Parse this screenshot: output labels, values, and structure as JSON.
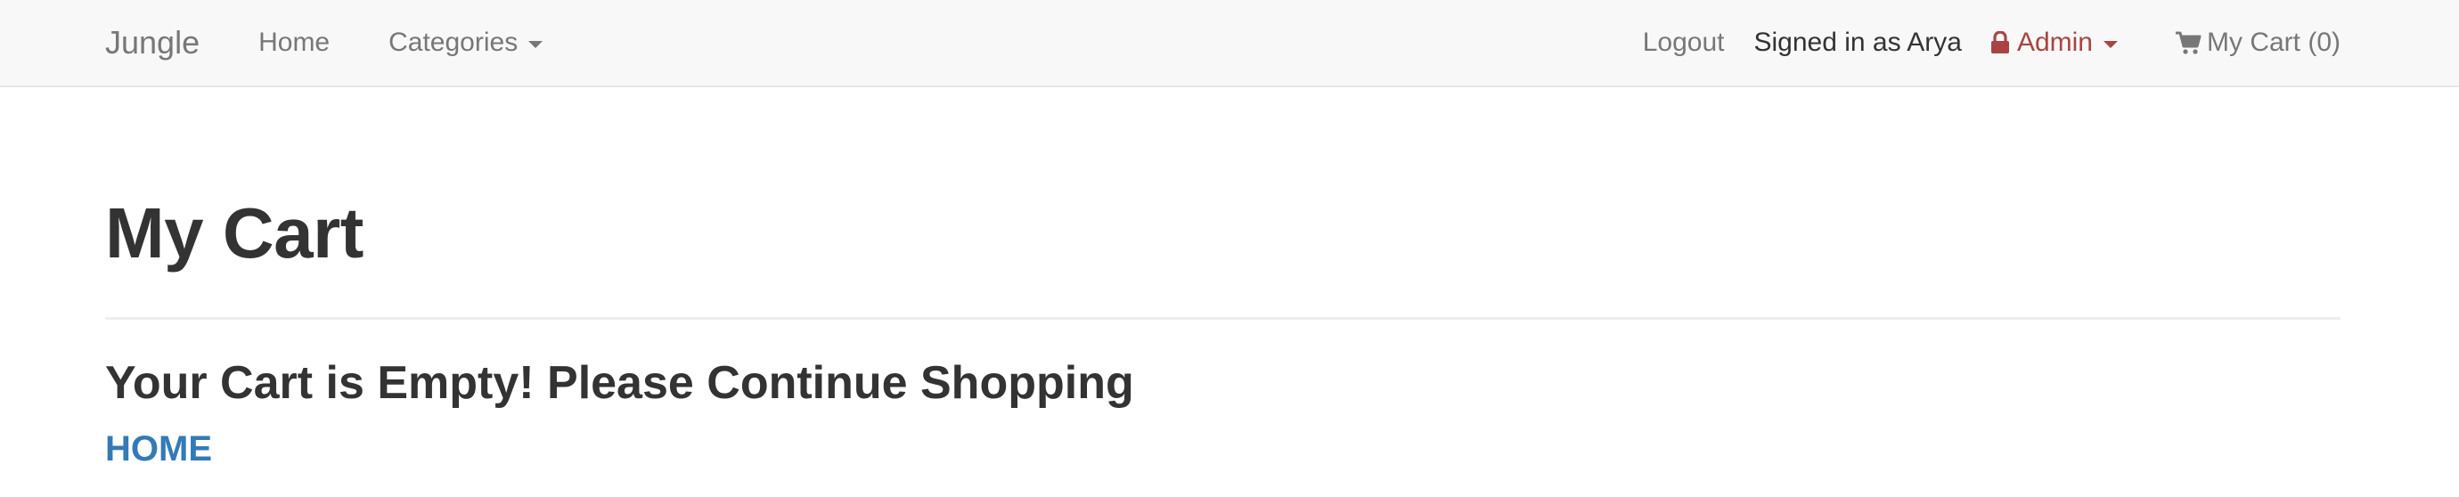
{
  "navbar": {
    "brand": "Jungle",
    "home_label": "Home",
    "categories_label": "Categories",
    "logout_label": "Logout",
    "signed_in_text": "Signed in as Arya",
    "admin_label": "Admin",
    "cart_label": "My Cart (0)",
    "icons": {
      "admin": "lock-icon",
      "cart": "shopping-cart-icon",
      "dropdown": "caret-down-icon"
    }
  },
  "main": {
    "title": "My Cart",
    "empty_message": "Your Cart is Empty! Please Continue Shopping",
    "home_link_label": "HOME"
  },
  "colors": {
    "navbar_bg": "#f8f8f8",
    "nav_text": "#777777",
    "admin_red": "#a94442",
    "link_blue": "#337ab7",
    "heading_text": "#333333"
  }
}
